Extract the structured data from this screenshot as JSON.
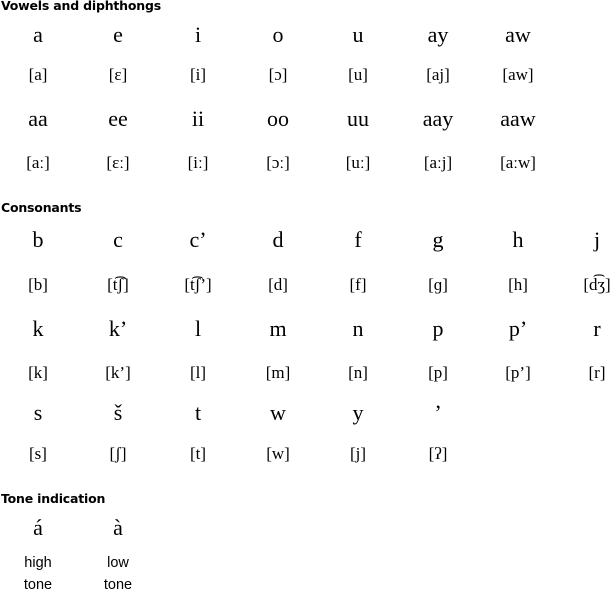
{
  "sections": {
    "vowels": {
      "heading": "Vowels and diphthongs",
      "rows": [
        {
          "type": "letters",
          "cells": [
            "a",
            "e",
            "i",
            "o",
            "u",
            "ay",
            "aw"
          ]
        },
        {
          "type": "ipa",
          "cells": [
            "[a]",
            "[ɛ]",
            "[i]",
            "[ɔ]",
            "[u]",
            "[aj]",
            "[aw]"
          ]
        },
        {
          "type": "letters",
          "cells": [
            "aa",
            "ee",
            "ii",
            "oo",
            "uu",
            "aay",
            "aaw"
          ]
        },
        {
          "type": "ipa",
          "cells": [
            "[aː]",
            "[ɛː]",
            "[iː]",
            "[ɔː]",
            "[uː]",
            "[aːj]",
            "[aːw]"
          ]
        }
      ]
    },
    "consonants": {
      "heading": "Consonants",
      "rows": [
        {
          "type": "letters",
          "cells": [
            "b",
            "c",
            "c’",
            "d",
            "f",
            "g",
            "h",
            "j"
          ]
        },
        {
          "type": "ipa",
          "cells": [
            "[b]",
            "[t͡ʃ]",
            "[t͡ʃ’]",
            "[d]",
            "[f]",
            "[ɡ]",
            "[h]",
            "[d͡ʒ]"
          ]
        },
        {
          "type": "letters",
          "cells": [
            "k",
            "k’",
            "l",
            "m",
            "n",
            "p",
            "p’",
            "r"
          ]
        },
        {
          "type": "ipa",
          "cells": [
            "[k]",
            "[k’]",
            "[l]",
            "[m]",
            "[n]",
            "[p]",
            "[p’]",
            "[r]"
          ]
        },
        {
          "type": "letters",
          "cells": [
            "s",
            "š",
            "t",
            "w",
            "y",
            "’"
          ]
        },
        {
          "type": "ipa",
          "cells": [
            "[s]",
            "[ʃ]",
            "[t]",
            "[w]",
            "[j]",
            "[ʔ]"
          ]
        }
      ]
    },
    "tone": {
      "heading": "Tone indication",
      "rows": [
        {
          "type": "letters",
          "cells": [
            "á",
            "à"
          ]
        },
        {
          "type": "label",
          "cells": [
            "high",
            "low"
          ]
        },
        {
          "type": "label",
          "cells": [
            "tone",
            "tone"
          ]
        }
      ]
    }
  }
}
